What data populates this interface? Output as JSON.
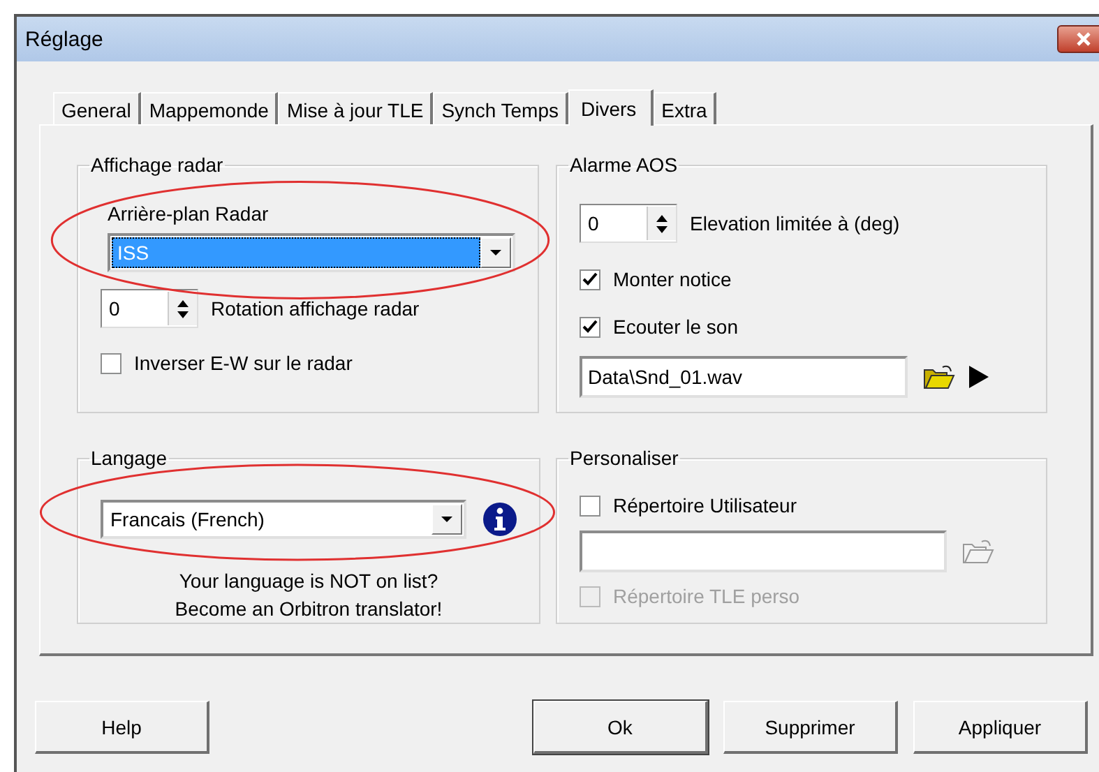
{
  "window": {
    "title": "Réglage"
  },
  "tabs": [
    {
      "label": "General",
      "selected": false
    },
    {
      "label": "Mappemonde",
      "selected": false
    },
    {
      "label": "Mise à jour TLE",
      "selected": false
    },
    {
      "label": "Synch Temps",
      "selected": false
    },
    {
      "label": "Divers",
      "selected": true
    },
    {
      "label": "Extra",
      "selected": false
    }
  ],
  "radar": {
    "title": "Affichage radar",
    "background_label": "Arrière-plan Radar",
    "background": {
      "value": "ISS",
      "highlighted": true,
      "circled": true
    },
    "rotation": {
      "value": "0",
      "label": "Rotation affichage radar"
    },
    "invert": {
      "label": "Inverser E-W sur le radar",
      "checked": false
    }
  },
  "language": {
    "title": "Langage",
    "value": "Francais (French)",
    "circled": true,
    "note": "Your language is NOT on list?\nBecome an Orbitron translator!"
  },
  "alarm": {
    "title": "Alarme AOS",
    "elevation": {
      "value": "0",
      "label": "Elevation limitée à (deg)"
    },
    "checks": [
      {
        "label": "Monter notice",
        "checked": true
      },
      {
        "label": "Ecouter le son",
        "checked": true
      }
    ],
    "sound_file": "Data\\Snd_01.wav",
    "browse_disabled": false
  },
  "custom": {
    "title": "Personaliser",
    "user_dir": {
      "label": "Répertoire Utilisateur",
      "checked": false,
      "disabled": false
    },
    "browse_disabled": true,
    "tle_dir": {
      "label": "Répertoire TLE perso",
      "checked": false,
      "disabled": true
    }
  },
  "buttons": [
    {
      "label": "Help",
      "default": false
    },
    {
      "label": "Ok",
      "default": true
    },
    {
      "label": "Supprimer",
      "default": false
    },
    {
      "label": "Appliquer",
      "default": false
    }
  ]
}
